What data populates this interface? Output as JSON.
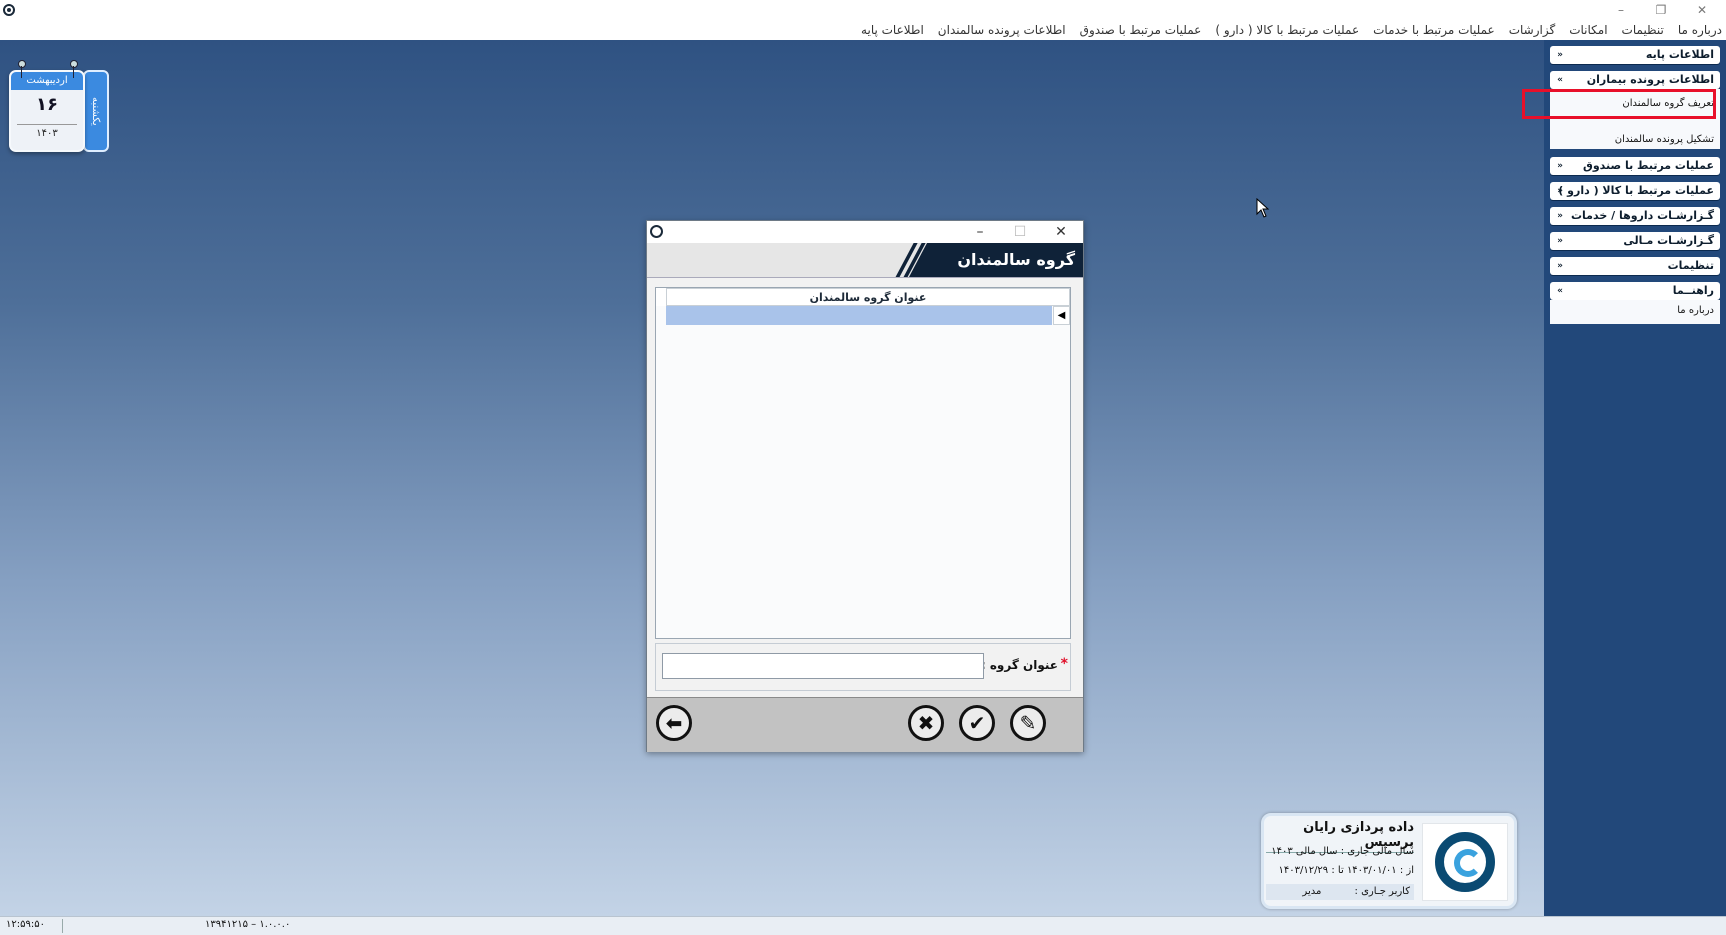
{
  "window": {
    "minimize": "–",
    "restore": "❐",
    "close": "✕"
  },
  "menu": [
    "اطلاعات پایه",
    "اطلاعات پرونده سالمندان",
    "عملیات مرتبط با صندوق",
    "عملیات مرتبط با کالا ( دارو )",
    "عملیات مرتبط با خدمات",
    "گزارشات",
    "امکانات",
    "تنظیمات",
    "درباره ما"
  ],
  "calendar": {
    "month": "اردیبهشت",
    "day": "۱۶",
    "year": "۱۴۰۳",
    "weekday": "یکشنبه"
  },
  "sidebar": {
    "groups": [
      {
        "label": "اطلاعات پایه",
        "chevron": "»"
      },
      {
        "label": "اطلاعات پرونده بیماران",
        "chevron": "«"
      },
      {
        "label": "عملیات مرتبط با صندوق",
        "chevron": "»"
      },
      {
        "label": "عملیات مرتبط با کالا ( دارو )",
        "chevron": "»"
      },
      {
        "label": "گـزارشـات داروها / خدمات",
        "chevron": "»"
      },
      {
        "label": "گـزارشـات مـالی",
        "chevron": "»"
      },
      {
        "label": "تنظیمات",
        "chevron": "»"
      },
      {
        "label": "راهنــما",
        "chevron": "«"
      }
    ],
    "patient_items": [
      "تعریف گروه سالمندان",
      "تشکیل پرونده سالمندان"
    ],
    "help_items": [
      "درباره ما"
    ]
  },
  "dialog": {
    "title": "گروه سالمندان",
    "minimize": "–",
    "maximize": "☐",
    "close": "✕",
    "grid": {
      "column_header": "عنوان گروه سالمندان",
      "row_indicator": "◀"
    },
    "field": {
      "required_mark": "*",
      "label": "عنوان گروه :",
      "value": ""
    },
    "buttons": {
      "edit": "✎",
      "confirm": "✔",
      "cancel": "✖",
      "back": "⬅"
    }
  },
  "company": {
    "name": "داده پردازی رایان پرسیس",
    "fiscal_year": "سال مالی جاری  :  سال مالی ۱۴۰۳",
    "range": "از :  ۱۴۰۳/۰۱/۰۱    تا :  ۱۴۰۳/۱۲/۲۹",
    "user_label": "کاربر جـاری :",
    "user_value": "مدیر"
  },
  "status": {
    "time": "۱۲:۵۹:۵۰",
    "version": "۱۳۹۴۱۲۱۵ – ۱.۰.۰.۰"
  },
  "colors": {
    "sidebar": "#22487a",
    "desktop_top": "#2f5282",
    "desktop_bottom": "#c3d3e6",
    "highlight": "#e8102a",
    "selected_row": "#a9c3ea",
    "dialog_header": "#0f2238"
  }
}
